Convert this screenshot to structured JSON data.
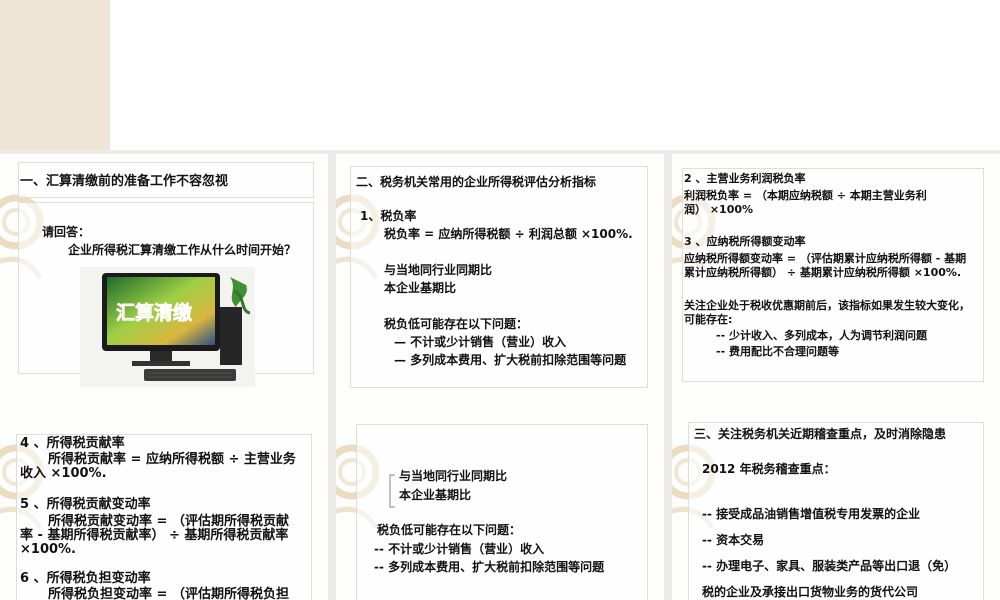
{
  "slide1": {
    "title": "一、汇算清缴前的准备工作不容忽视",
    "prompt": "请回答：",
    "question": "企业所得税汇算清缴工作从什么时间开始？",
    "screen_text": "汇算清缴"
  },
  "slide2": {
    "title": "二、税务机关常用的企业所得税评估分析指标",
    "item1": "1、税负率",
    "formula": "税负率 = 应纳所得税额 ÷ 利润总额 ×100%.",
    "compare1": "与当地同行业同期比",
    "compare2": "本企业基期比",
    "issues": "税负低可能存在以下问题：",
    "issue1": "— 不计或少计销售（营业）收入",
    "issue2": "— 多列成本费用、扩大税前扣除范围等问题"
  },
  "slide3": {
    "h2": "2 、主营业务利润税负率",
    "f2a": "利润税负率 = （本期应纳税额 ÷ 本期主营业务利",
    "f2b": "润） ×100%",
    "h3": "3 、应纳税所得额变动率",
    "f3a": "应纳税所得额变动率 = （评估期累计应纳税所得额 - 基期",
    "f3b": "累计应纳税所得额） ÷ 基期累计应纳税所得额 ×100%.",
    "note_a": "关注企业处于税收优惠期前后，该指标如果发生较大变化，",
    "note_b": "可能存在:",
    "b1": "-- 少计收入、多列成本，人为调节利润问题",
    "b2": "-- 费用配比不合理问题等"
  },
  "slide4": {
    "h4": "4 、所得税贡献率",
    "f4a": "所得税贡献率 = 应纳所得税额 ÷ 主营业务",
    "f4b": "收入 ×100%.",
    "h5": "5 、所得税贡献变动率",
    "f5a": "所得税贡献变动率 = （评估期所得税贡献",
    "f5b": "率 - 基期所得税贡献率） ÷ 基期所得税贡献率",
    "f5c": "×100%.",
    "h6": "6 、所得税负担变动率",
    "f6a": "所得税负担变动率 = （评估期所得税负担"
  },
  "slide5": {
    "compare1": "与当地同行业同期比",
    "compare2": "本企业基期比",
    "issues": "税负低可能存在以下问题：",
    "issue1": "-- 不计或少计销售（营业）收入",
    "issue2": "-- 多列成本费用、扩大税前扣除范围等问题"
  },
  "slide6": {
    "title": "三、关注税务机关近期稽查重点，及时消除隐患",
    "subtitle": "2012 年税务稽查重点：",
    "p1": "-- 接受成品油销售增值税专用发票的企业",
    "p2": "-- 资本交易",
    "p3": "-- 办理电子、家具、服装类产品等出口退（免）",
    "p4": "税的企业及承接出口货物业务的货代公司"
  }
}
